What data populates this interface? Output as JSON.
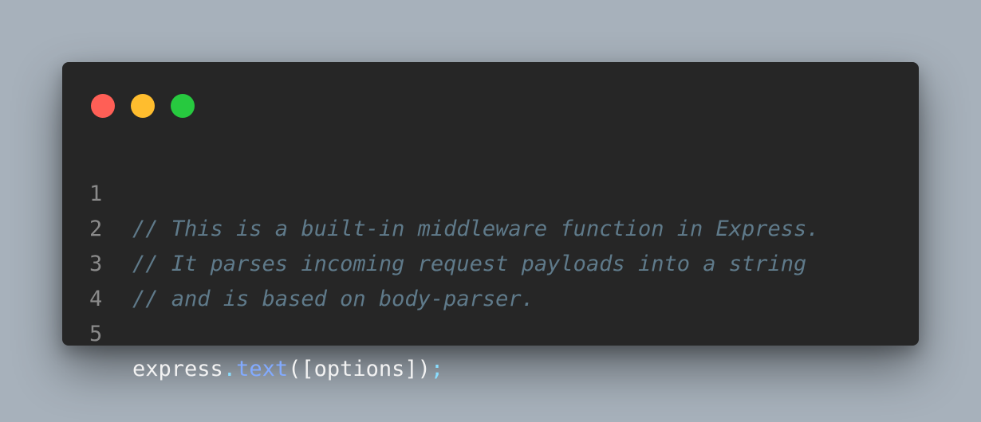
{
  "colors": {
    "background": "#a7b1bb",
    "window": "#262626",
    "close_dot": "#ff5f56",
    "minimize_dot": "#ffbd2e",
    "maximize_dot": "#27c93f",
    "line_number": "#8a8a8a",
    "comment": "#5f7a8a",
    "identifier": "#f2f2f2",
    "method": "#82aaff",
    "punctuation": "#89ddff"
  },
  "window_controls": [
    {
      "name": "close-dot",
      "color": "#ff5f56"
    },
    {
      "name": "minimize-dot",
      "color": "#ffbd2e"
    },
    {
      "name": "maximize-dot",
      "color": "#27c93f"
    }
  ],
  "code": {
    "lines": [
      {
        "number": "1",
        "comment": "// This is a built-in middleware function in Express."
      },
      {
        "number": "2",
        "comment": "// It parses incoming request payloads into a string"
      },
      {
        "number": "3",
        "comment": "// and is based on body-parser."
      },
      {
        "number": "4",
        "comment": ""
      },
      {
        "number": "5",
        "object": "express",
        "dot": ".",
        "method": "text",
        "args": "([options])",
        "semicolon": ";"
      }
    ]
  }
}
